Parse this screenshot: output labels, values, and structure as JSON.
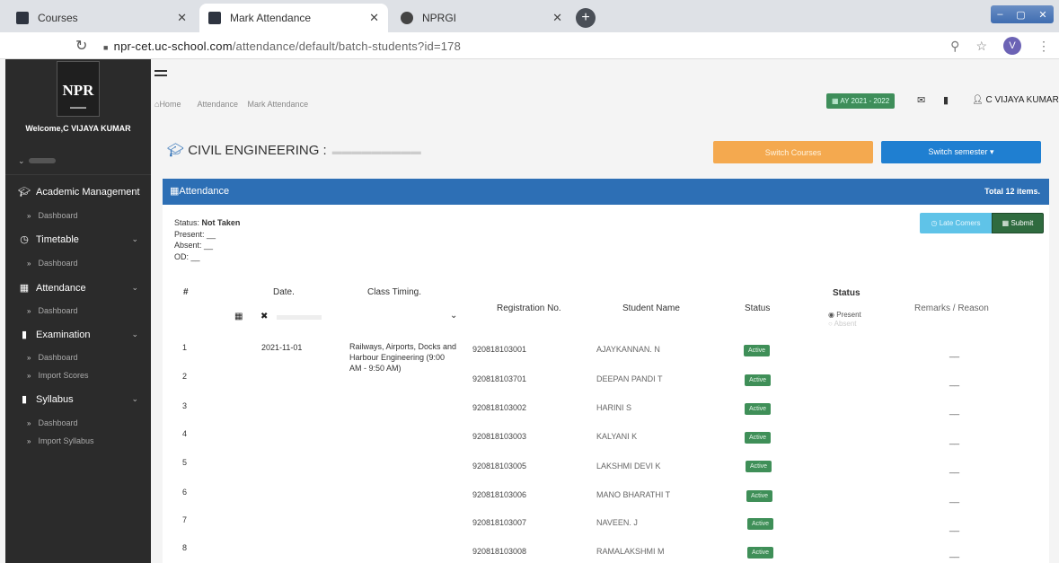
{
  "browser": {
    "tabs": [
      {
        "title": "Courses"
      },
      {
        "title": "Mark Attendance"
      },
      {
        "title": "NPRGI"
      }
    ],
    "url_host": "npr-cet.uc-school.com",
    "url_path": "/attendance/default/batch-students?id=178",
    "avatar_letter": "V"
  },
  "sidebar": {
    "logo_text": "NPR",
    "welcome": "Welcome,C VIJAYA KUMAR",
    "menu": [
      {
        "label": "Academic Management",
        "icon": "graduation-cap-icon"
      },
      {
        "label": "Timetable",
        "icon": "clock-icon"
      },
      {
        "label": "Attendance",
        "icon": "calendar-icon"
      },
      {
        "label": "Examination",
        "icon": "file-icon"
      },
      {
        "label": "Syllabus",
        "icon": "file-icon"
      }
    ],
    "submenus": {
      "academic": [
        "Dashboard"
      ],
      "timetable": [
        "Dashboard"
      ],
      "attendance": [
        "Dashboard"
      ],
      "examination": [
        "Dashboard",
        "Import Scores"
      ],
      "syllabus": [
        "Dashboard",
        "Import Syllabus"
      ]
    }
  },
  "header": {
    "academic_year": "AY 2021 - 2022",
    "user": "C VIJAYA KUMAR"
  },
  "breadcrumb": [
    "Home",
    "Attendance",
    "Mark Attendance"
  ],
  "course": {
    "title": "CIVIL ENGINEERING :",
    "switch_courses": "Switch Courses",
    "switch_semester": "Switch semester ▾"
  },
  "panel": {
    "title": "Attendance",
    "total": "Total 12 items."
  },
  "status_summary": {
    "status_label": "Status:",
    "status_value": "Not Taken",
    "present": "Present: __",
    "absent": "Absent: __",
    "od": "OD: __"
  },
  "actions": {
    "late_comers": "Late Comers",
    "submit": "Submit"
  },
  "table": {
    "headers": {
      "num": "#",
      "date": "Date.",
      "timing": "Class Timing.",
      "reg": "Registration No.",
      "name": "Student Name",
      "status": "Status",
      "status2": "Status",
      "remarks": "Remarks / Reason"
    },
    "radio_present": "Present",
    "radio_absent": "Absent",
    "date": "2021-11-01",
    "timing": "Railways, Airports, Docks and Harbour Engineering (9:00 AM - 9:50 AM)",
    "rows": [
      {
        "n": "1",
        "reg": "920818103001",
        "name": "AJAYKANNAN. N",
        "status": "Active",
        "remark": "__"
      },
      {
        "n": "2",
        "reg": "920818103701",
        "name": "DEEPAN PANDI T",
        "status": "Active",
        "remark": "__"
      },
      {
        "n": "3",
        "reg": "920818103002",
        "name": "HARINI S",
        "status": "Active",
        "remark": "__"
      },
      {
        "n": "4",
        "reg": "920818103003",
        "name": "KALYANI K",
        "status": "Active",
        "remark": "__"
      },
      {
        "n": "5",
        "reg": "920818103005",
        "name": "LAKSHMI DEVI K",
        "status": "Active",
        "remark": "__"
      },
      {
        "n": "6",
        "reg": "920818103006",
        "name": "MANO BHARATHI T",
        "status": "Active",
        "remark": "__"
      },
      {
        "n": "7",
        "reg": "920818103007",
        "name": "NAVEEN. J",
        "status": "Active",
        "remark": "__"
      },
      {
        "n": "8",
        "reg": "920818103008",
        "name": "RAMALAKSHMI M",
        "status": "Active",
        "remark": "__"
      }
    ]
  },
  "colors": {
    "sidebar_bg": "#2b2b2b",
    "panel_header": "#2d6fb5",
    "switch_courses": "#f4a94f",
    "switch_semester": "#1f7fd1",
    "active_badge": "#3f8f58"
  }
}
